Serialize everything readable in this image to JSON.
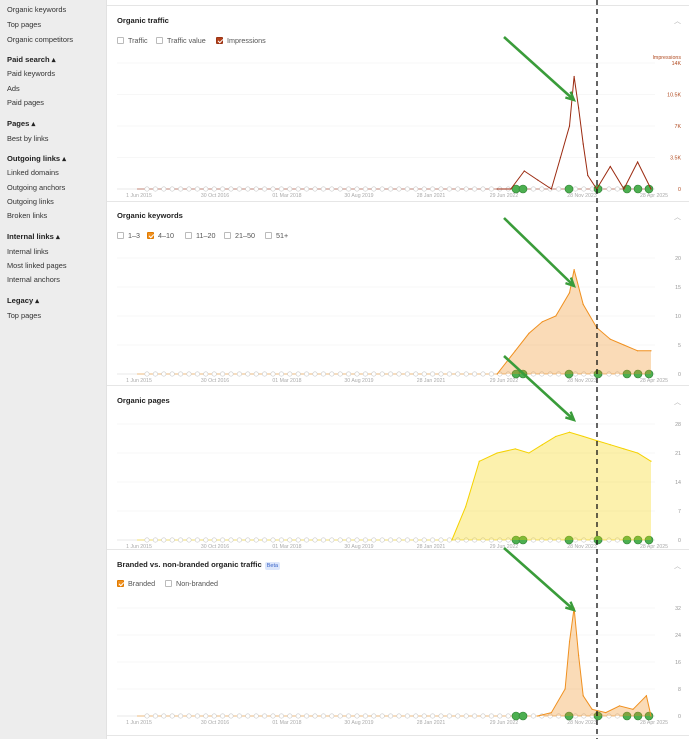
{
  "sidebar": {
    "top_items": [
      "Organic keywords",
      "Top pages",
      "Organic competitors"
    ],
    "sections": [
      {
        "title": "Paid search ▴",
        "items": [
          "Paid keywords",
          "Ads",
          "Paid pages"
        ]
      },
      {
        "title": "Pages ▴",
        "items": [
          "Best by links"
        ]
      },
      {
        "title": "Outgoing links ▴",
        "items": [
          "Linked domains",
          "Outgoing anchors",
          "Outgoing links",
          "Broken links"
        ]
      },
      {
        "title": "Internal links ▴",
        "items": [
          "Internal links",
          "Most linked pages",
          "Internal anchors"
        ]
      },
      {
        "title": "Legacy ▴",
        "items": [
          "Top pages"
        ]
      }
    ]
  },
  "x_axis_labels": [
    "1 Jun 2015",
    "30 Oct 2016",
    "01 Mar 2018",
    "30 Aug 2019",
    "28 Jan 2021",
    "29 Jun 2022",
    "28 Nov 2023",
    "28 Apr 2025"
  ],
  "collapse_icon": "chevron-up-icon",
  "panels": {
    "organic_traffic": {
      "title": "Organic traffic",
      "options": [
        {
          "label": "Traffic",
          "checked": false
        },
        {
          "label": "Traffic value",
          "checked": false
        },
        {
          "label": "Impressions",
          "checked": true
        }
      ],
      "y_axis_title": "Impressions",
      "y_ticks": [
        "14K",
        "10.5K",
        "7K",
        "3.5K",
        "0"
      ],
      "color": "#9b2a10"
    },
    "organic_keywords": {
      "title": "Organic keywords",
      "options": [
        {
          "label": "1–3",
          "checked": false
        },
        {
          "label": "4–10",
          "checked": true
        },
        {
          "label": "11–20",
          "checked": false
        },
        {
          "label": "21–50",
          "checked": false
        },
        {
          "label": "51+",
          "checked": false
        }
      ],
      "y_ticks": [
        "20",
        "15",
        "10",
        "5",
        "0"
      ],
      "color": "#f0901f"
    },
    "organic_pages": {
      "title": "Organic pages",
      "y_ticks": [
        "28",
        "21",
        "14",
        "7",
        "0"
      ],
      "color": "#f5d200"
    },
    "branded": {
      "title": "Branded vs. non-branded organic traffic",
      "badge": "Beta",
      "options": [
        {
          "label": "Branded",
          "checked": true
        },
        {
          "label": "Non-branded",
          "checked": false
        }
      ],
      "y_ticks": [
        "32",
        "24",
        "16",
        "8",
        "0"
      ],
      "color": "#f0901f"
    }
  },
  "chart_data": [
    {
      "type": "line",
      "title": "Organic traffic",
      "series_name": "Impressions",
      "ylim": [
        0,
        14000
      ],
      "x": [
        "2022-06",
        "2022-09",
        "2022-12",
        "2023-03",
        "2023-06",
        "2023-08",
        "2023-10",
        "2023-11",
        "2023-12",
        "2024-01",
        "2024-02",
        "2024-04",
        "2024-07",
        "2024-10",
        "2025-01",
        "2025-04"
      ],
      "values": [
        0,
        0,
        2000,
        1000,
        0,
        3500,
        7000,
        12500,
        9000,
        5000,
        1500,
        0,
        2500,
        0,
        3000,
        0
      ]
    },
    {
      "type": "area",
      "title": "Organic keywords",
      "series_name": "4–10",
      "ylim": [
        0,
        20
      ],
      "x": [
        "2022-06",
        "2022-10",
        "2023-01",
        "2023-04",
        "2023-07",
        "2023-10",
        "2023-11",
        "2024-01",
        "2024-04",
        "2024-07",
        "2024-10",
        "2025-01",
        "2025-04"
      ],
      "values": [
        0,
        4,
        7,
        9,
        10,
        14,
        18,
        12,
        8,
        6,
        5,
        4,
        4
      ]
    },
    {
      "type": "area",
      "title": "Organic pages",
      "ylim": [
        0,
        28
      ],
      "x": [
        "2021-08",
        "2021-11",
        "2022-02",
        "2022-06",
        "2022-10",
        "2023-01",
        "2023-04",
        "2023-07",
        "2023-10",
        "2024-01",
        "2024-04",
        "2024-07",
        "2024-10",
        "2025-01",
        "2025-04"
      ],
      "values": [
        0,
        8,
        19,
        21,
        22,
        21,
        23,
        25,
        26,
        25,
        24,
        23,
        22,
        21,
        19
      ]
    },
    {
      "type": "area",
      "title": "Branded vs. non-branded organic traffic",
      "series_name": "Branded",
      "ylim": [
        0,
        32
      ],
      "x": [
        "2023-03",
        "2023-06",
        "2023-09",
        "2023-10",
        "2023-11",
        "2023-12",
        "2024-01",
        "2024-03",
        "2024-06",
        "2024-09",
        "2024-12",
        "2025-03",
        "2025-04"
      ],
      "values": [
        0,
        1,
        8,
        22,
        32,
        18,
        6,
        2,
        1,
        3,
        2,
        6,
        0
      ]
    }
  ]
}
